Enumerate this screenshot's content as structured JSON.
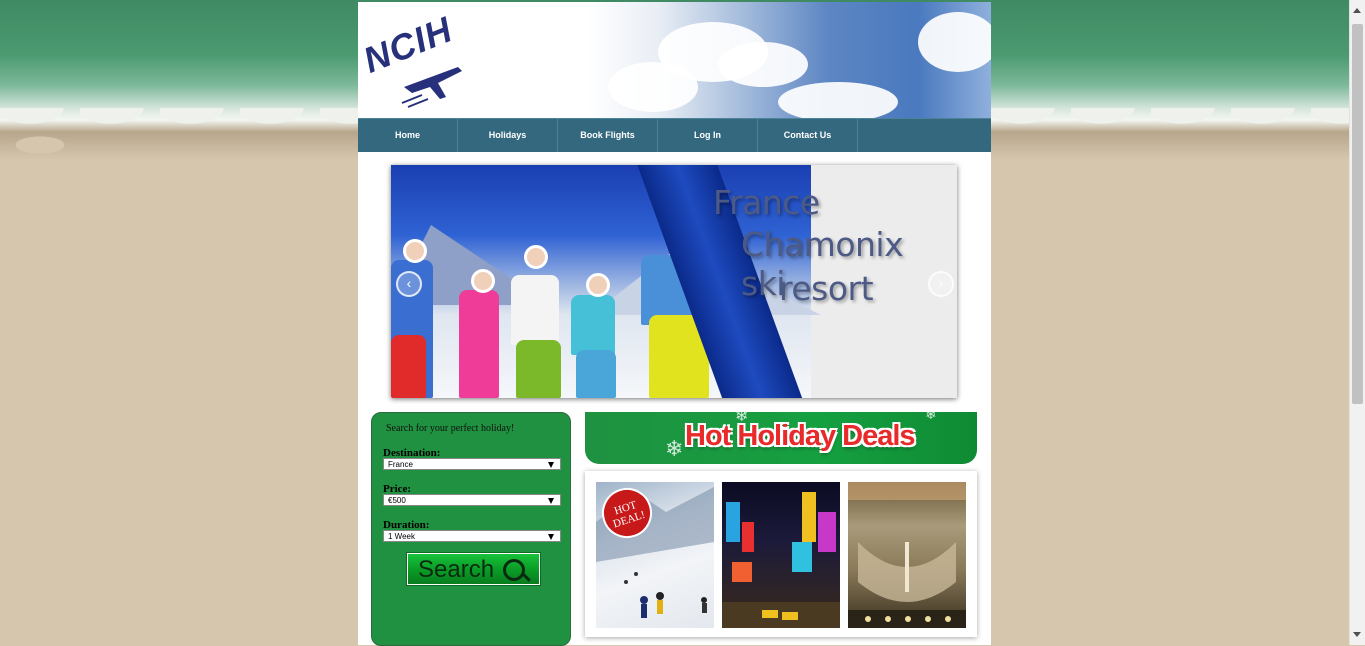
{
  "site": {
    "logo_text": "NCIH"
  },
  "nav": {
    "items": [
      {
        "label": "Home"
      },
      {
        "label": "Holidays"
      },
      {
        "label": "Book Flights"
      },
      {
        "label": "Log In"
      },
      {
        "label": "Contact Us"
      }
    ]
  },
  "slider": {
    "line1": "France",
    "line2": "Chamonix ski",
    "line3": "resort",
    "prev_icon": "chevron-left-icon",
    "next_icon": "chevron-right-icon"
  },
  "search": {
    "title": "Search for your perfect holiday!",
    "destination_label": "Destination:",
    "destination_value": "France",
    "price_label": "Price:",
    "price_value": "€500",
    "duration_label": "Duration:",
    "duration_value": "1 Week",
    "button_label": "Search",
    "button_icon": "search-icon"
  },
  "deals": {
    "banner_title": "Hot Holiday Deals",
    "badge_text_1": "HOT",
    "badge_text_2": "DEAL!",
    "images": [
      "ski-slope-image",
      "times-square-image",
      "vatican-square-image"
    ]
  },
  "colors": {
    "nav_bg": "#33687e",
    "search_panel": "#1f9140",
    "deals_title": "#e82a2a"
  }
}
